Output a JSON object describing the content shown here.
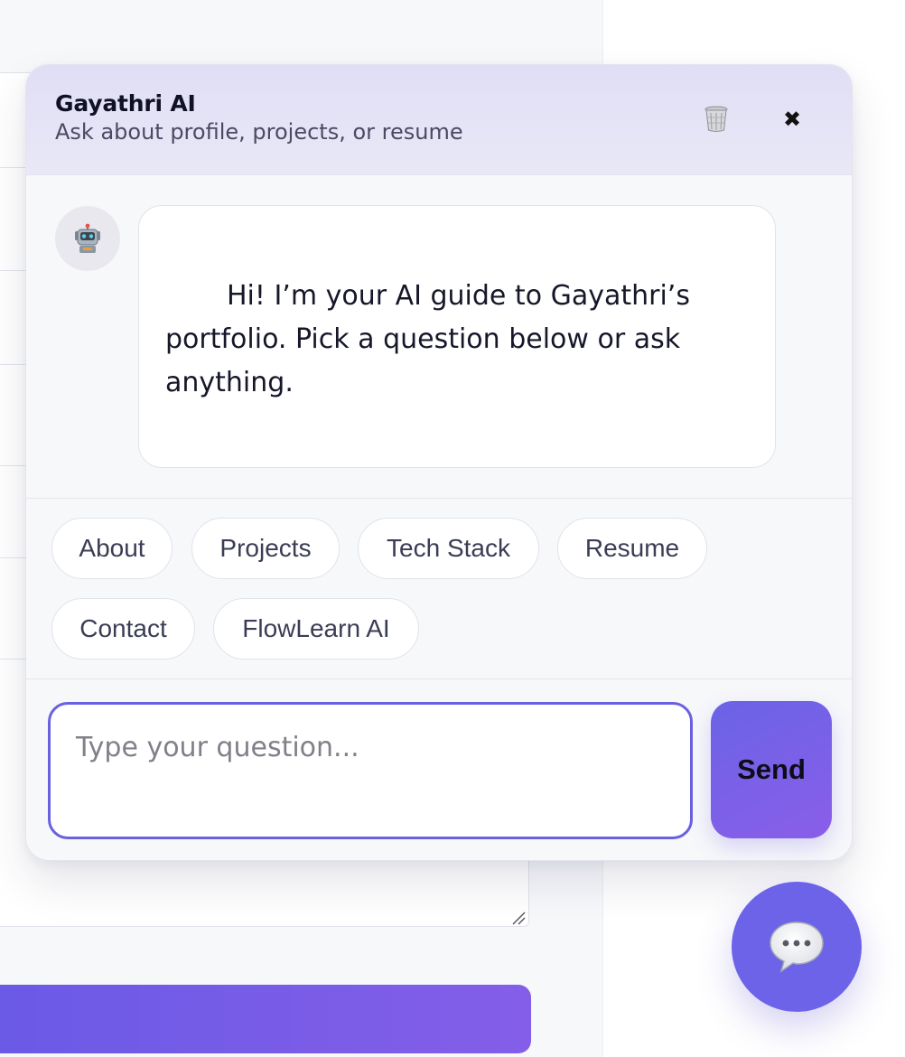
{
  "chat": {
    "title": "Gayathri AI",
    "subtitle": "Ask about profile, projects, or resume",
    "clear_icon": "trash-icon",
    "close_icon": "close-icon",
    "close_glyph": "✖",
    "bot_avatar_icon": "robot-icon",
    "messages": [
      {
        "role": "bot",
        "text": "Hi! I’m your AI guide to Gayathri’s portfolio. Pick a question below or ask anything."
      }
    ],
    "quick_replies": [
      "About",
      "Projects",
      "Tech Stack",
      "Resume",
      "Contact",
      "FlowLearn AI"
    ],
    "input": {
      "placeholder": "Type your question...",
      "value": ""
    },
    "send_label": "Send"
  },
  "launcher": {
    "icon": "chat-bubble-icon"
  },
  "colors": {
    "accent": "#6c63e8",
    "header_bg": "#e0def5",
    "input_border": "#6961e0"
  }
}
